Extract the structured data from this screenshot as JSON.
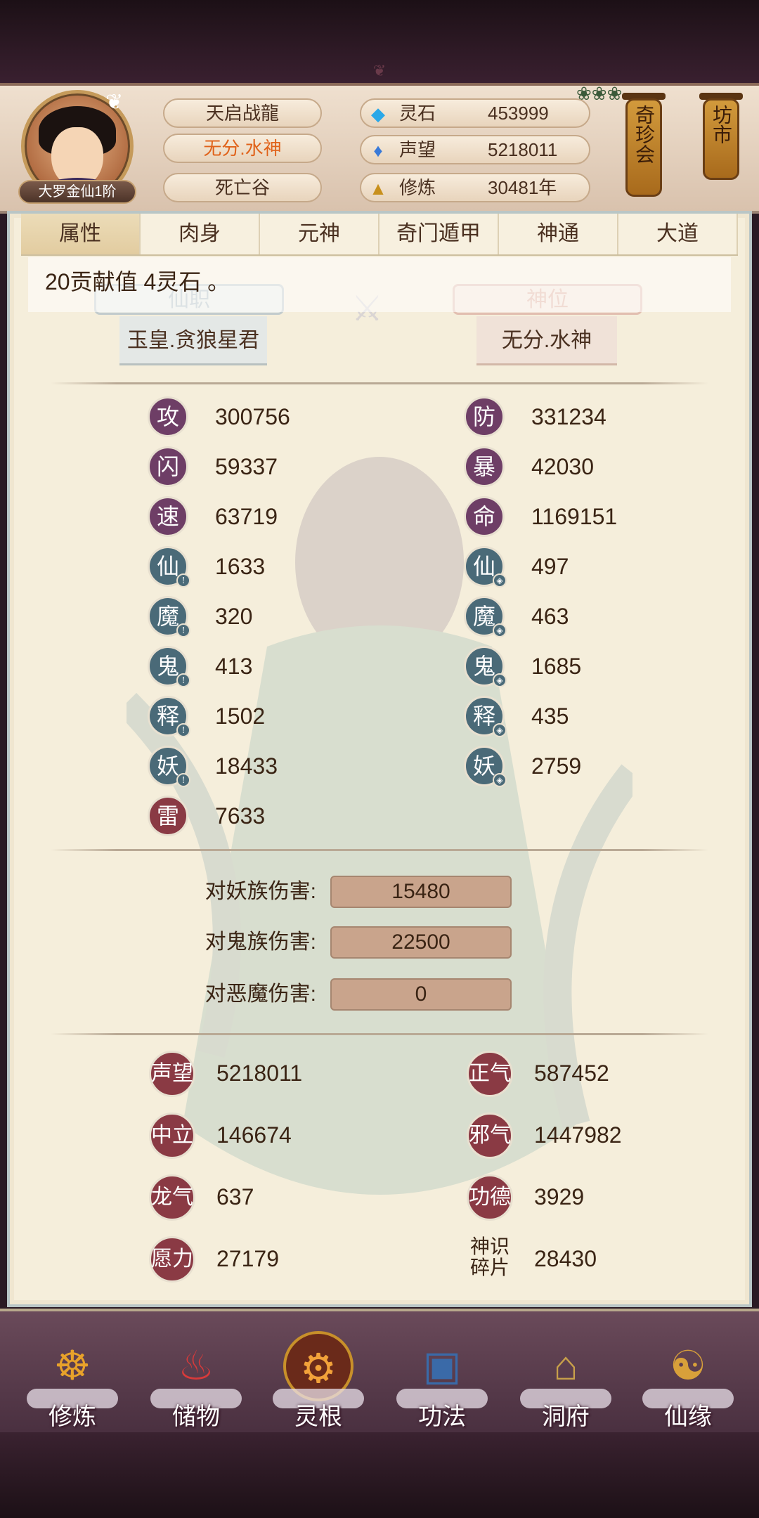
{
  "header": {
    "rank_badge": "大罗金仙1阶",
    "name": "天启战龍",
    "title": "无分.水神",
    "location": "死亡谷",
    "resources": [
      {
        "icon": "spirit-stone-icon",
        "label": "灵石",
        "value": "453999"
      },
      {
        "icon": "reputation-icon",
        "label": "声望",
        "value": "5218011"
      },
      {
        "icon": "cultivation-icon",
        "label": "修炼",
        "value": "30481年"
      }
    ],
    "lanterns": [
      {
        "label": "奇珍会"
      },
      {
        "label": "坊市"
      }
    ]
  },
  "tabs": [
    {
      "label": "属性",
      "active": true
    },
    {
      "label": "肉身",
      "active": false
    },
    {
      "label": "元神",
      "active": false
    },
    {
      "label": "奇门遁甲",
      "active": false
    },
    {
      "label": "神通",
      "active": false
    },
    {
      "label": "大道",
      "active": false
    }
  ],
  "notice": "20贡献值 4灵石 。",
  "rank": {
    "xianzhi_label": "仙职",
    "xianzhi_value": "玉皇.贪狼星君",
    "shenwei_label": "神位",
    "shenwei_value": "无分.水神"
  },
  "stats_left": [
    {
      "glyph": "攻",
      "value": "300756"
    },
    {
      "glyph": "闪",
      "value": "59337"
    },
    {
      "glyph": "速",
      "value": "63719"
    },
    {
      "glyph": "仙",
      "value": "1633"
    },
    {
      "glyph": "魔",
      "value": "320"
    },
    {
      "glyph": "鬼",
      "value": "413"
    },
    {
      "glyph": "释",
      "value": "1502"
    },
    {
      "glyph": "妖",
      "value": "18433"
    },
    {
      "glyph": "雷",
      "value": "7633"
    }
  ],
  "stats_right": [
    {
      "glyph": "防",
      "value": "331234"
    },
    {
      "glyph": "暴",
      "value": "42030"
    },
    {
      "glyph": "命",
      "value": "1169151"
    },
    {
      "glyph": "仙",
      "value": "497"
    },
    {
      "glyph": "魔",
      "value": "463"
    },
    {
      "glyph": "鬼",
      "value": "1685"
    },
    {
      "glyph": "释",
      "value": "435"
    },
    {
      "glyph": "妖",
      "value": "2759"
    }
  ],
  "damage": [
    {
      "label": "对妖族伤害:",
      "value": "15480"
    },
    {
      "label": "对鬼族伤害:",
      "value": "22500"
    },
    {
      "label": "对恶魔伤害:",
      "value": "0"
    }
  ],
  "reputation_left": [
    {
      "label": "声望",
      "value": "5218011"
    },
    {
      "label": "中立",
      "value": "146674"
    },
    {
      "label": "龙气",
      "value": "637"
    },
    {
      "label": "愿力",
      "value": "27179"
    }
  ],
  "reputation_right": [
    {
      "label": "正气",
      "value": "587452"
    },
    {
      "label": "邪气",
      "value": "1447982"
    },
    {
      "label": "功德",
      "value": "3929"
    },
    {
      "label": "神识碎片",
      "line1": "神识",
      "line2": "碎片",
      "value": "28430"
    }
  ],
  "bottom_nav": [
    {
      "label": "修炼",
      "icon": "meditating-figure-icon"
    },
    {
      "label": "储物",
      "icon": "storage-bag-icon"
    },
    {
      "label": "灵根",
      "icon": "spirit-root-orb-icon"
    },
    {
      "label": "功法",
      "icon": "book-icon"
    },
    {
      "label": "洞府",
      "icon": "pavilion-icon"
    },
    {
      "label": "仙缘",
      "icon": "gourd-icon"
    }
  ],
  "colors": {
    "accent_orange": "#e0621a",
    "paper": "#f5eedb",
    "badge_purple": "#6e3e66",
    "badge_teal": "#4a6a78",
    "badge_red": "#8a3a44"
  }
}
